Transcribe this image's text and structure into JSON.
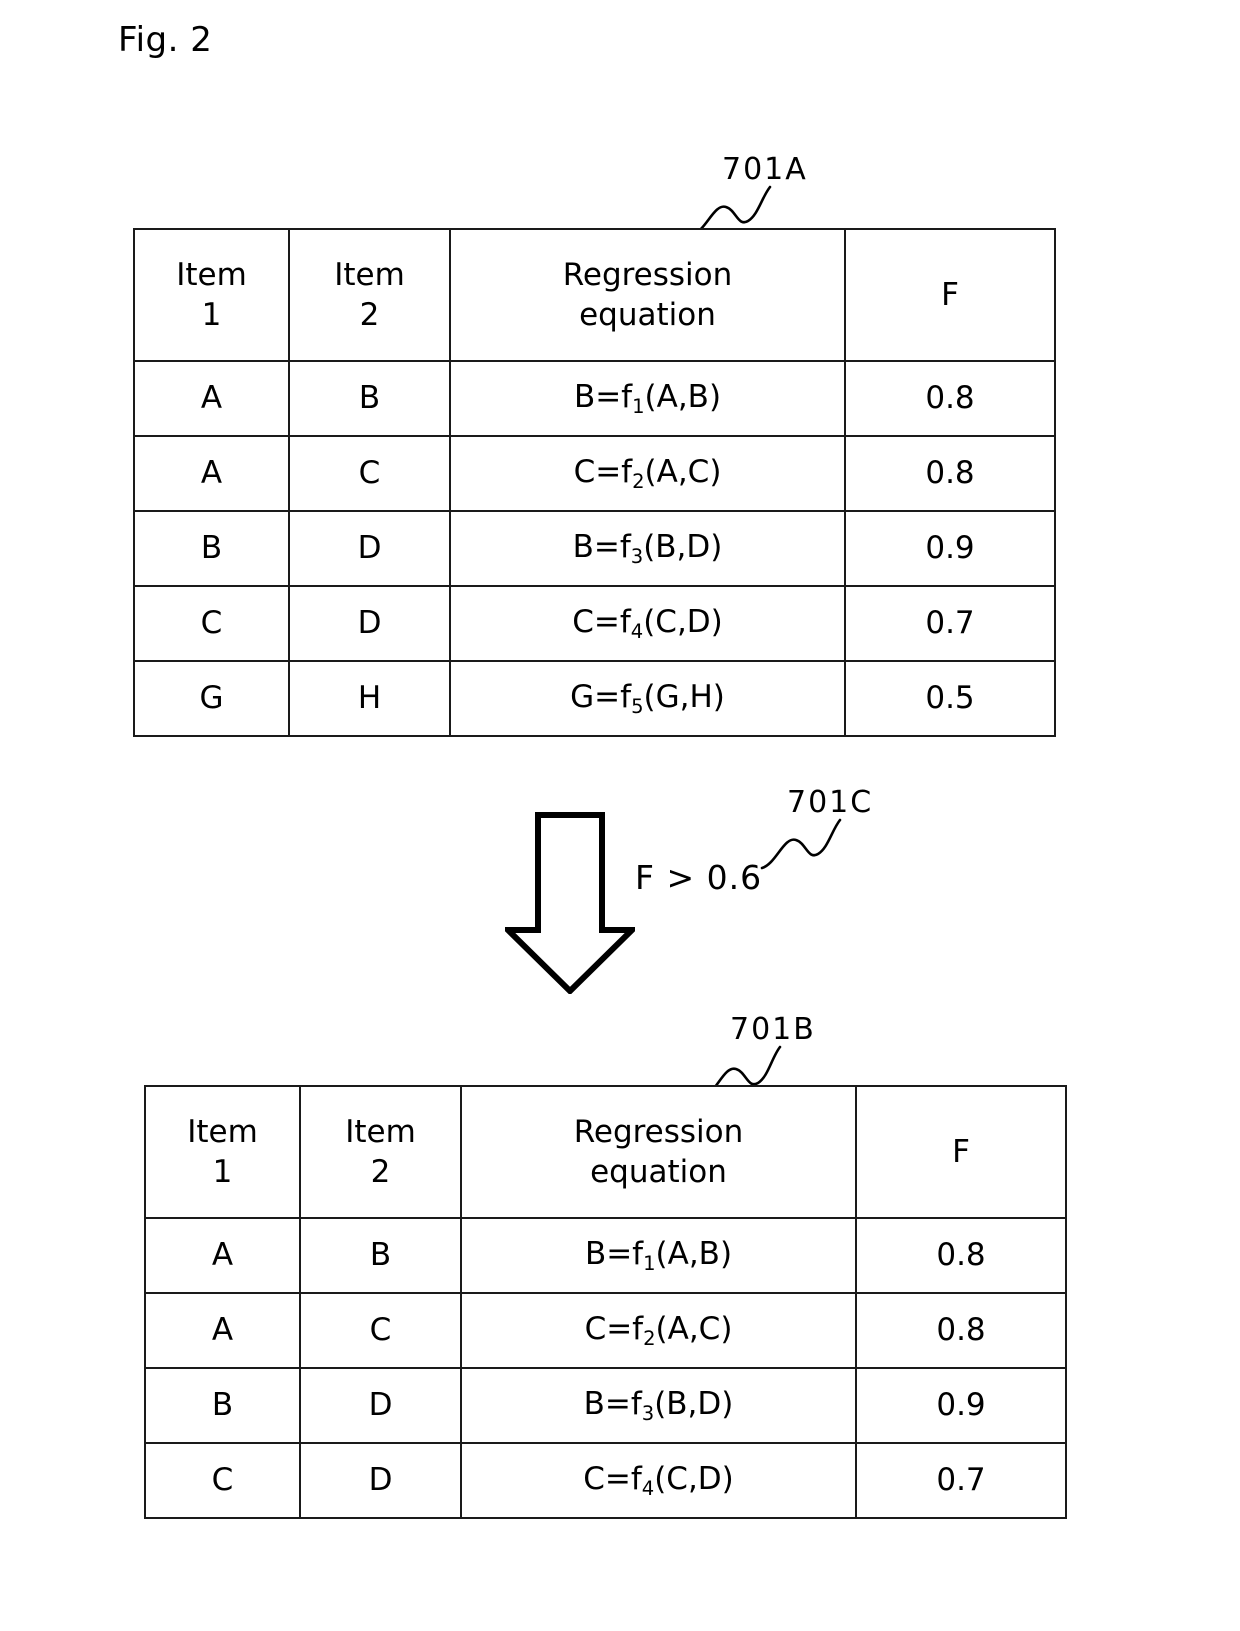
{
  "figure": {
    "title": "Fig. 2"
  },
  "callouts": {
    "table_before": "701A",
    "table_after": "701B",
    "condition": "701C"
  },
  "flow": {
    "arrow_icon": "down-arrow-outline",
    "condition_label": "F > 0.6"
  },
  "table_columns": {
    "item1_line1": "Item",
    "item1_line2": "1",
    "item2_line1": "Item",
    "item2_line2": "2",
    "equation_line1": "Regression",
    "equation_line2": "equation",
    "f": "F"
  },
  "table_before": {
    "rows": [
      {
        "item1": "A",
        "item2": "B",
        "eq_lhs": "B=f",
        "eq_sub": "1",
        "eq_args": "(A,B)",
        "f": "0.8"
      },
      {
        "item1": "A",
        "item2": "C",
        "eq_lhs": "C=f",
        "eq_sub": "2",
        "eq_args": "(A,C)",
        "f": "0.8"
      },
      {
        "item1": "B",
        "item2": "D",
        "eq_lhs": "B=f",
        "eq_sub": "3",
        "eq_args": "(B,D)",
        "f": "0.9"
      },
      {
        "item1": "C",
        "item2": "D",
        "eq_lhs": "C=f",
        "eq_sub": "4",
        "eq_args": "(C,D)",
        "f": "0.7"
      },
      {
        "item1": "G",
        "item2": "H",
        "eq_lhs": "G=f",
        "eq_sub": "5",
        "eq_args": "(G,H)",
        "f": "0.5"
      }
    ]
  },
  "table_after": {
    "rows": [
      {
        "item1": "A",
        "item2": "B",
        "eq_lhs": "B=f",
        "eq_sub": "1",
        "eq_args": "(A,B)",
        "f": "0.8"
      },
      {
        "item1": "A",
        "item2": "C",
        "eq_lhs": "C=f",
        "eq_sub": "2",
        "eq_args": "(A,C)",
        "f": "0.8"
      },
      {
        "item1": "B",
        "item2": "D",
        "eq_lhs": "B=f",
        "eq_sub": "3",
        "eq_args": "(B,D)",
        "f": "0.9"
      },
      {
        "item1": "C",
        "item2": "D",
        "eq_lhs": "C=f",
        "eq_sub": "4",
        "eq_args": "(C,D)",
        "f": "0.7"
      }
    ]
  },
  "colors": {
    "ink": "#000000",
    "background": "#ffffff"
  }
}
